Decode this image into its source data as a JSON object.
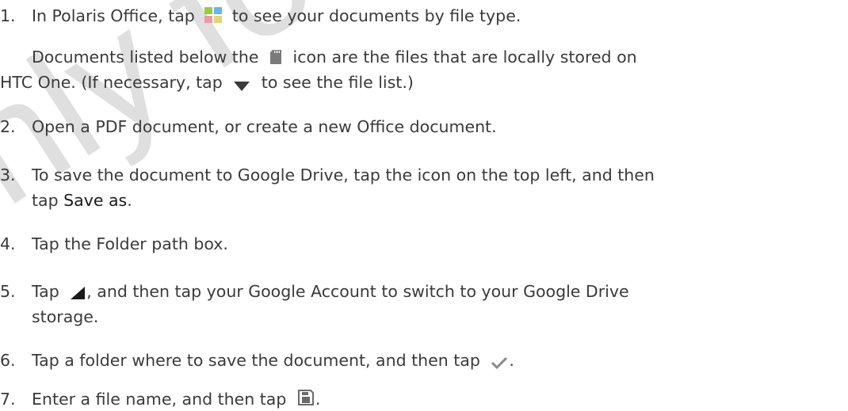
{
  "watermark": {
    "text": "Only for certification",
    "color": "#dcdcdc"
  },
  "steps": [
    {
      "number": "1.",
      "parts": {
        "a": "In Polaris Office, tap",
        "b": "to see your documents by file type."
      },
      "icon": "file-type-grid-icon",
      "note": {
        "line1_a": "Documents listed below the",
        "line1_b": "icon are the files that are locally stored on",
        "line2_a": "HTC One. (If necessary, tap",
        "line2_b": "to see the file list.)",
        "icons": [
          "sd-card-icon",
          "triangle-down-icon"
        ]
      }
    },
    {
      "number": "2.",
      "text": "Open a PDF document, or create a new Office document."
    },
    {
      "number": "3.",
      "line1": "To save the document to Google Drive, tap the icon on the top left, and then",
      "line2_a": "tap",
      "line2_bold": "Save as",
      "line2_b": "."
    },
    {
      "number": "4.",
      "text": "Tap the Folder path box."
    },
    {
      "number": "5.",
      "line1_a": "Tap",
      "line1_b": ", and then tap your Google Account to switch to your Google Drive",
      "line2": "storage.",
      "icon": "corner-triangle-icon"
    },
    {
      "number": "6.",
      "text_a": "Tap a folder where to save the document, and then tap",
      "text_b": ".",
      "icon": "checkmark-icon"
    },
    {
      "number": "7.",
      "text_a": "Enter a file name, and then tap",
      "text_b": ".",
      "icon": "save-icon"
    }
  ],
  "colors": {
    "text": "#3a3a3a",
    "grid_green": "#9ccc3c",
    "grid_blue": "#6ab4e6",
    "grid_pink": "#e89aa6",
    "grid_yellow": "#e6d37a",
    "icon_grey": "#7a7a7a"
  }
}
